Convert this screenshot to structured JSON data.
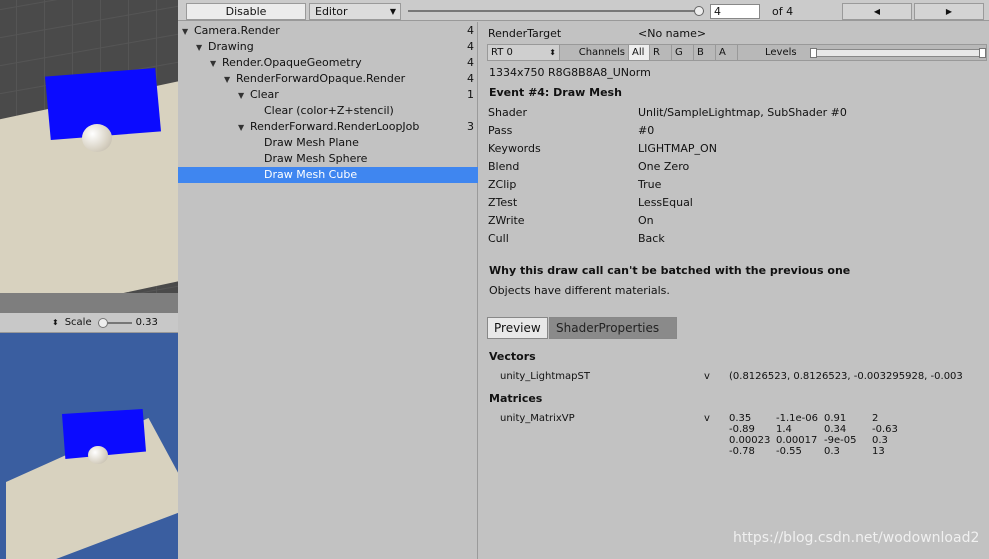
{
  "toolbar": {
    "disable_label": "Disable",
    "editor_label": "Editor",
    "event_number": "4",
    "of_total": "of 4",
    "prev_icon": "◀",
    "next_icon": "▶"
  },
  "game_view": {
    "scale_label": "Scale",
    "scale_value": "0.33"
  },
  "tree": {
    "items": [
      {
        "label": "Camera.Render",
        "count": "4"
      },
      {
        "label": "Drawing",
        "count": "4"
      },
      {
        "label": "Render.OpaqueGeometry",
        "count": "4"
      },
      {
        "label": "RenderForwardOpaque.Render",
        "count": "4"
      },
      {
        "label": "Clear",
        "count": "1"
      },
      {
        "label": "Clear (color+Z+stencil)",
        "count": ""
      },
      {
        "label": "RenderForward.RenderLoopJob",
        "count": "3"
      },
      {
        "label": "Draw Mesh Plane",
        "count": ""
      },
      {
        "label": "Draw Mesh Sphere",
        "count": ""
      },
      {
        "label": "Draw Mesh Cube",
        "count": ""
      }
    ]
  },
  "details": {
    "render_target_label": "RenderTarget",
    "render_target_value": "<No name>",
    "rt_select": "RT 0",
    "channels_label": "Channels",
    "channels": [
      "All",
      "R",
      "G",
      "B",
      "A"
    ],
    "levels_label": "Levels",
    "format": "1334x750 R8G8B8A8_UNorm",
    "event_title": "Event #4: Draw Mesh",
    "properties": [
      {
        "name": "Shader",
        "value": "Unlit/SampleLightmap, SubShader #0"
      },
      {
        "name": "Pass",
        "value": "#0"
      },
      {
        "name": "Keywords",
        "value": "LIGHTMAP_ON"
      },
      {
        "name": "Blend",
        "value": "One Zero"
      },
      {
        "name": "ZClip",
        "value": "True"
      },
      {
        "name": "ZTest",
        "value": "LessEqual"
      },
      {
        "name": "ZWrite",
        "value": "On"
      },
      {
        "name": "Cull",
        "value": "Back"
      }
    ],
    "batch_heading": "Why this draw call can't be batched with the previous one",
    "batch_reason": "Objects have different materials.",
    "tab_preview": "Preview",
    "tab_shader_properties": "ShaderProperties",
    "vectors_heading": "Vectors",
    "vector_name": "unity_LightmapST",
    "vector_type": "v",
    "vector_value": "(0.8126523, 0.8126523, -0.003295928, -0.003",
    "matrices_heading": "Matrices",
    "matrix_name": "unity_MatrixVP",
    "matrix_type": "v",
    "matrix_rows": [
      [
        "0.35",
        "-1.1e-06",
        "0.91",
        "2"
      ],
      [
        "-0.89",
        "1.4",
        "0.34",
        "-0.63"
      ],
      [
        "0.00023",
        "0.00017",
        "-9e-05",
        "0.3"
      ],
      [
        "-0.78",
        "-0.55",
        "0.3",
        "13"
      ]
    ]
  },
  "watermark": "https://blog.csdn.net/wodownload2"
}
